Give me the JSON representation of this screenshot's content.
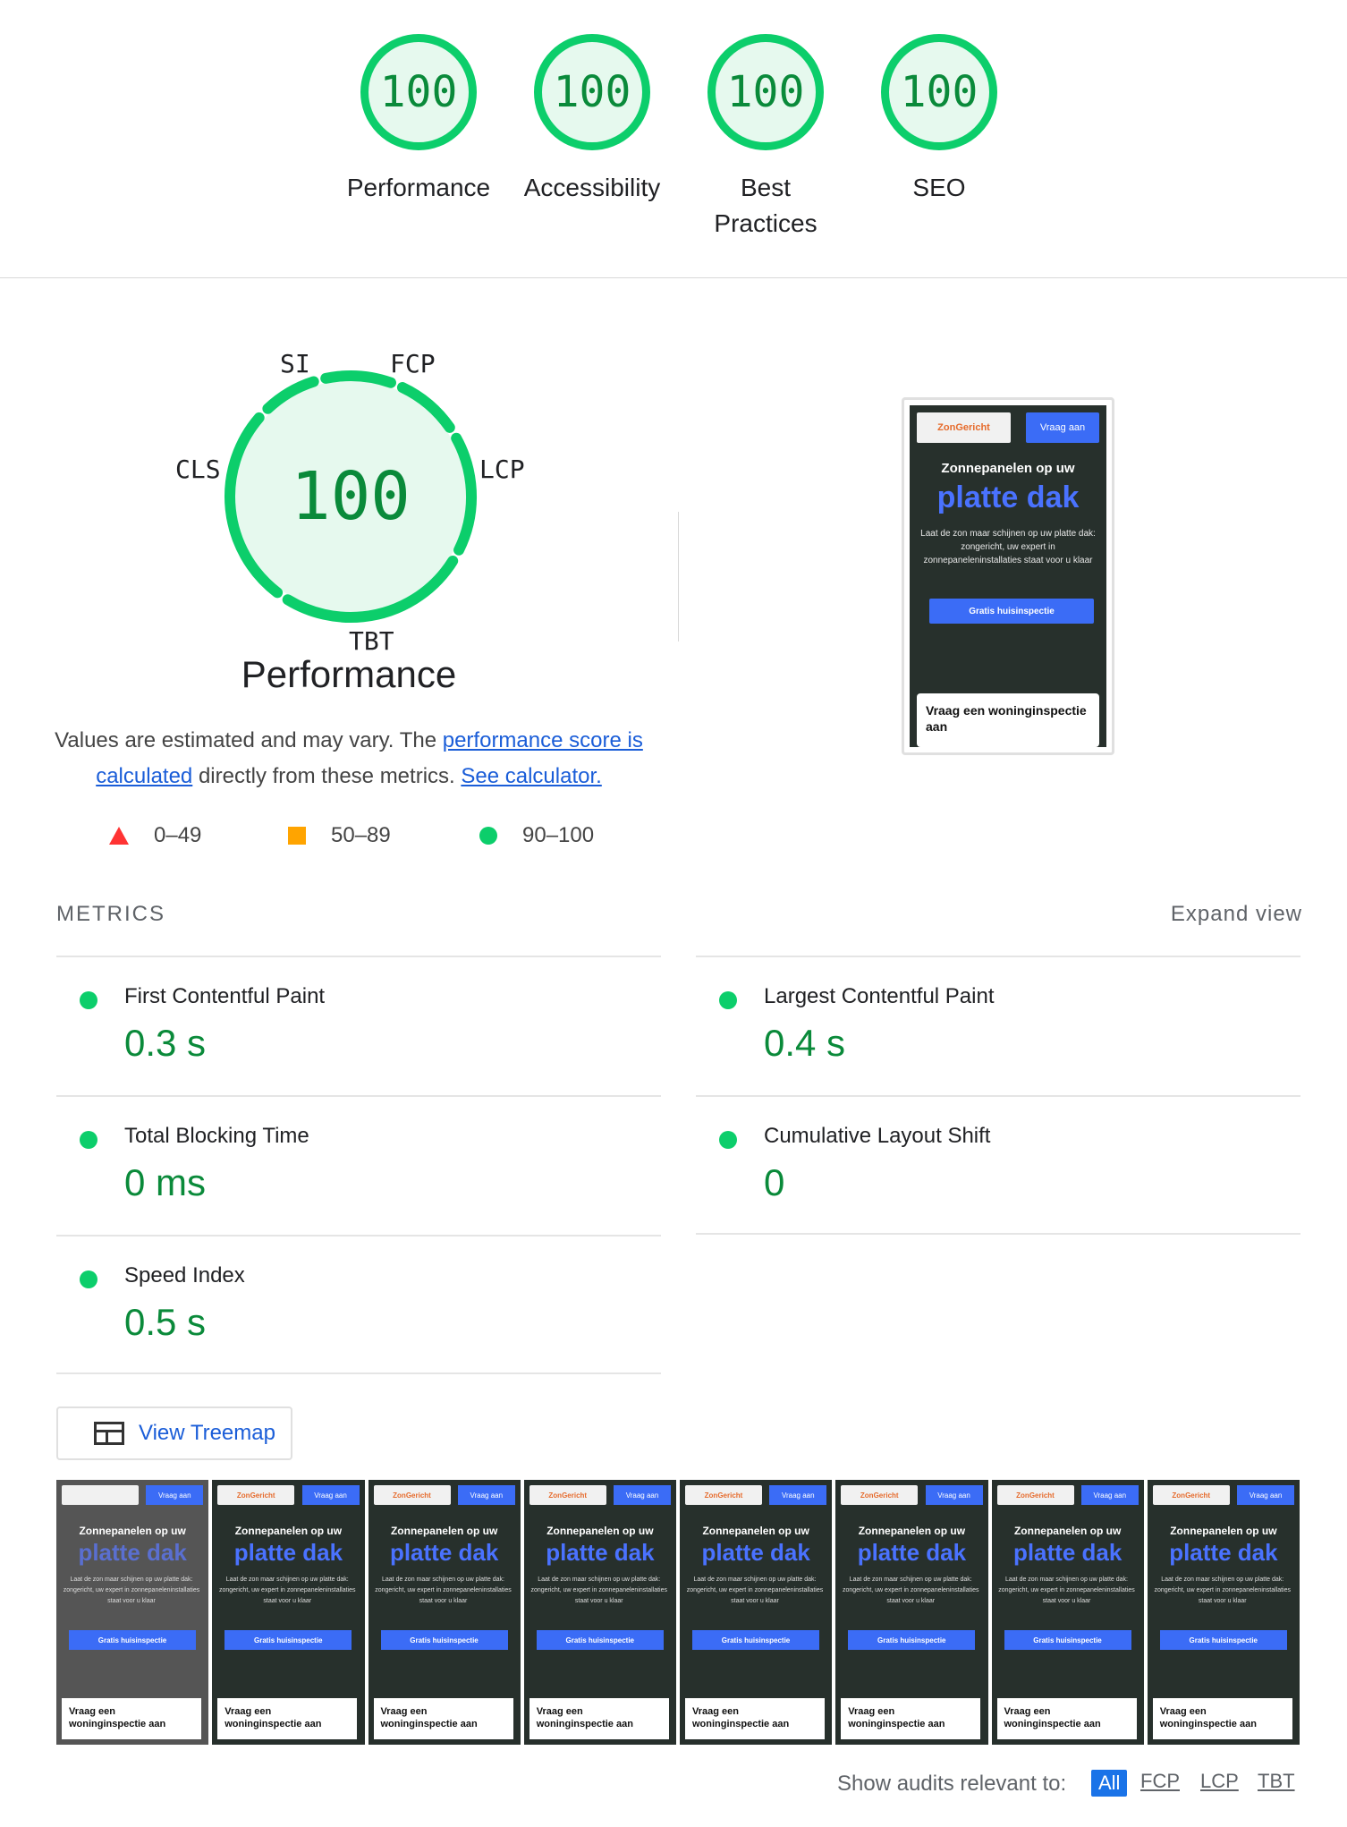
{
  "top_gauges": [
    {
      "score": "100",
      "label": "Performance"
    },
    {
      "score": "100",
      "label": "Accessibility"
    },
    {
      "score": "100",
      "label": "Best Practices"
    },
    {
      "score": "100",
      "label": "SEO"
    }
  ],
  "main_gauge": {
    "score": "100",
    "title": "Performance",
    "labels": {
      "si": "SI",
      "fcp": "FCP",
      "cls": "CLS",
      "lcp": "LCP",
      "tbt": "TBT"
    }
  },
  "description": {
    "part1": "Values are estimated and may vary. The",
    "link1": "performance score is calculated",
    "part2": "directly from these metrics.",
    "link2": "See calculator."
  },
  "legend": [
    {
      "range": "0–49"
    },
    {
      "range": "50–89"
    },
    {
      "range": "90–100"
    }
  ],
  "screenshot": {
    "logo": "ZonGericht",
    "button": "Vraag aan",
    "heading": "Zonnepanelen op uw",
    "highlight": "platte dak",
    "paragraph": "Laat de zon maar schijnen op uw platte dak: zongericht, uw expert in zonnepaneleninstallaties staat voor u klaar",
    "cta": "Gratis huisinspectie",
    "card": "Vraag een woninginspectie aan"
  },
  "metrics": {
    "heading": "METRICS",
    "expand": "Expand view",
    "items": [
      {
        "name": "First Contentful Paint",
        "value": "0.3 s"
      },
      {
        "name": "Largest Contentful Paint",
        "value": "0.4 s"
      },
      {
        "name": "Total Blocking Time",
        "value": "0 ms"
      },
      {
        "name": "Cumulative Layout Shift",
        "value": "0"
      },
      {
        "name": "Speed Index",
        "value": "0.5 s"
      }
    ]
  },
  "treemap": {
    "label": "View Treemap"
  },
  "filmstrip": {
    "frame_count": 8
  },
  "filters": {
    "label": "Show audits relevant to:",
    "options": [
      "All",
      "FCP",
      "LCP",
      "TBT"
    ],
    "active": "All"
  },
  "colors": {
    "pass": "#0cce6b",
    "pass_text": "#0a8a3a",
    "average": "#ffa400",
    "fail": "#ff3333",
    "link": "#1a5dd8"
  }
}
